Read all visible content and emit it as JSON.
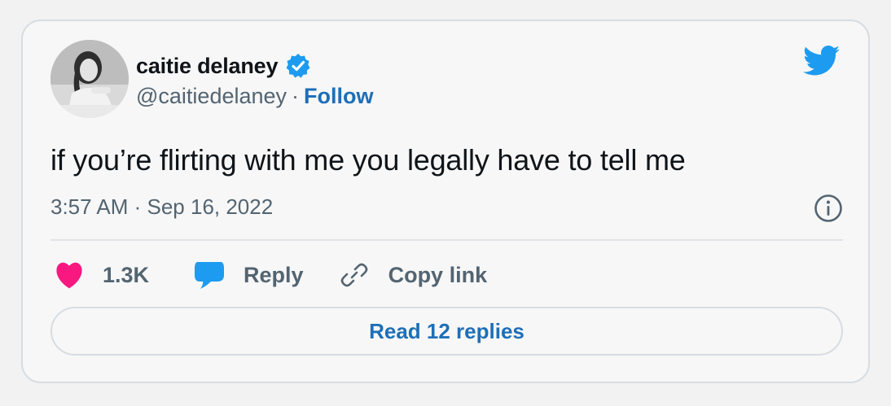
{
  "tweet": {
    "display_name": "caitie delaney",
    "handle": "@caitiedelaney",
    "separator": "·",
    "follow_label": "Follow",
    "text": "if you’re flirting with me you legally have to tell me",
    "timestamp": "3:57 AM · Sep 16, 2022",
    "verified": true
  },
  "actions": {
    "likes_count": "1.3K",
    "reply_label": "Reply",
    "copy_link_label": "Copy link"
  },
  "footer": {
    "read_replies_label": "Read 12 replies"
  },
  "icons": {
    "brand": "twitter-bird-icon",
    "verified": "verified-badge-icon",
    "info": "info-icon",
    "like": "heart-icon",
    "reply": "speech-bubble-icon",
    "copy": "link-icon"
  },
  "colors": {
    "accent": "#1d9bf0",
    "link": "#1d6fb8",
    "heart": "#f91880",
    "text": "#0f1419",
    "muted": "#536471"
  }
}
